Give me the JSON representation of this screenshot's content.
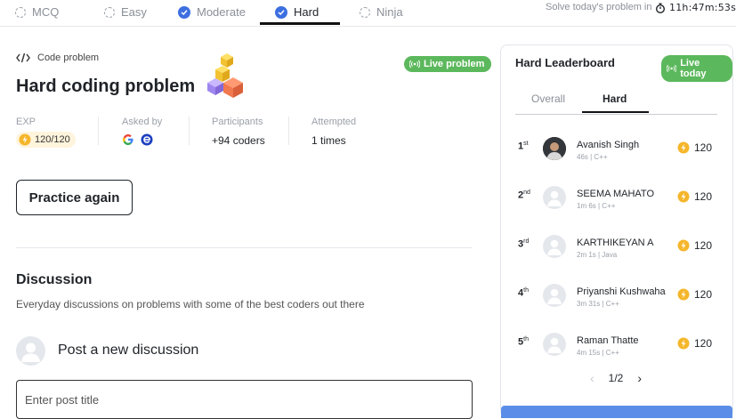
{
  "top_tabs": [
    {
      "label": "MCQ",
      "state": "unchecked"
    },
    {
      "label": "Easy",
      "state": "unchecked"
    },
    {
      "label": "Moderate",
      "state": "checked"
    },
    {
      "label": "Hard",
      "state": "checked-active"
    },
    {
      "label": "Ninja",
      "state": "unchecked"
    }
  ],
  "solve_text": "Solve today's problem in",
  "timer": "11h:47m:53s",
  "problem": {
    "category": "Code problem",
    "live_label": "Live problem",
    "title": "Hard coding problem",
    "stats": {
      "exp_label": "EXP",
      "exp_value": "120/120",
      "asked_label": "Asked by",
      "participants_label": "Participants",
      "participants_value": "+94 coders",
      "attempted_label": "Attempted",
      "attempted_value": "1 times"
    },
    "practice_label": "Practice again"
  },
  "discussion": {
    "title": "Discussion",
    "subtitle": "Everyday discussions on problems with some of the best coders out there",
    "post_label": "Post a new discussion",
    "input_placeholder": "Enter post title"
  },
  "leaderboard": {
    "title": "Hard Leaderboard",
    "live_label": "Live today",
    "tabs": [
      "Overall",
      "Hard"
    ],
    "rows": [
      {
        "rank": "1",
        "suffix": "st",
        "name": "Avanish Singh",
        "meta": "46s | C++",
        "score": "120"
      },
      {
        "rank": "2",
        "suffix": "nd",
        "name": "SEEMA MAHATO",
        "meta": "1m 6s | C++",
        "score": "120"
      },
      {
        "rank": "3",
        "suffix": "rd",
        "name": "KARTHIKEYAN A",
        "meta": "2m 1s | Java",
        "score": "120"
      },
      {
        "rank": "4",
        "suffix": "th",
        "name": "Priyanshi Kushwaha",
        "meta": "3m 31s | C++",
        "score": "120"
      },
      {
        "rank": "5",
        "suffix": "th",
        "name": "Raman Thatte",
        "meta": "4m 15s | C++",
        "score": "120"
      }
    ],
    "page": "1/2"
  },
  "colors": {
    "live_green": "#5cb85c",
    "accent_blue": "#3d6fe0",
    "coin": "#f5b62b"
  }
}
